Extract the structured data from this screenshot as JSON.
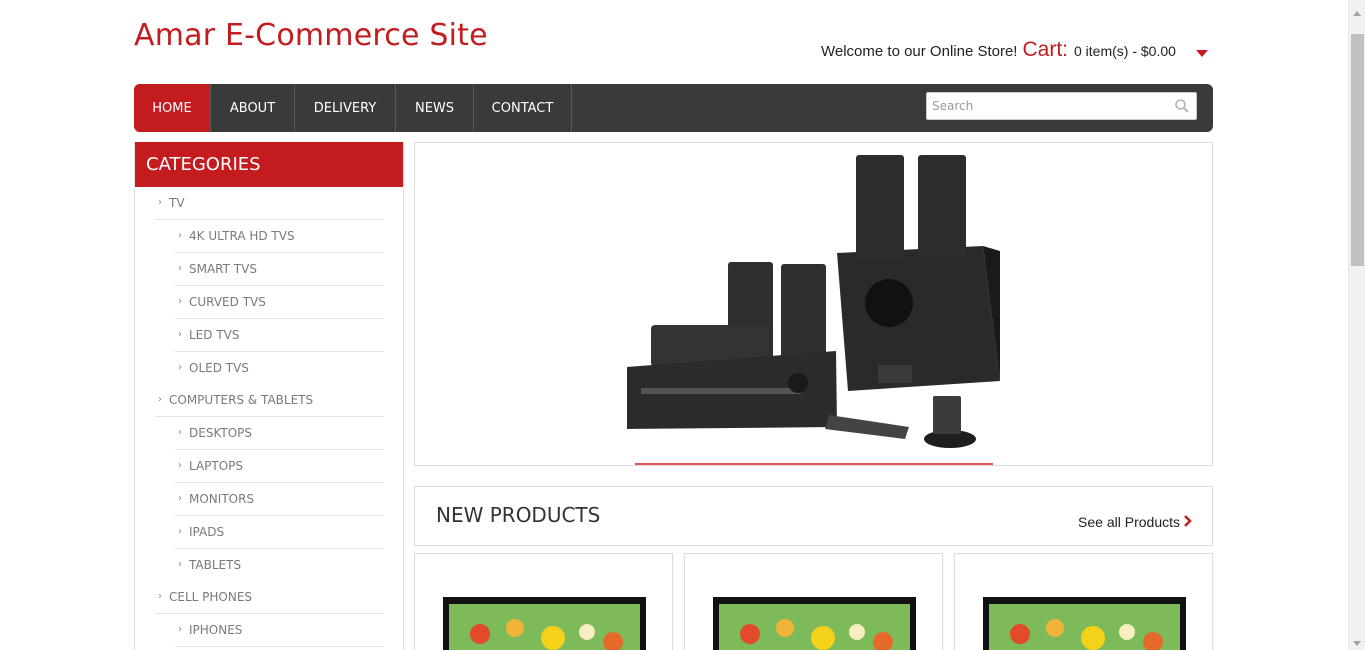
{
  "site": {
    "title": "Amar E-Commerce Site"
  },
  "header": {
    "welcome": "Welcome to our Online Store!",
    "cart_label": "Cart:",
    "cart_summary": "0 item(s) - $0.00"
  },
  "nav": {
    "items": [
      "HOME",
      "ABOUT",
      "DELIVERY",
      "NEWS",
      "CONTACT"
    ],
    "active": "HOME",
    "search_placeholder": "Search"
  },
  "sidebar": {
    "title": "CATEGORIES",
    "items": [
      {
        "label": "TV",
        "level": 0
      },
      {
        "label": "4K ULTRA HD TVS",
        "level": 1
      },
      {
        "label": "SMART TVS",
        "level": 1
      },
      {
        "label": "CURVED TVS",
        "level": 1
      },
      {
        "label": "LED TVS",
        "level": 1
      },
      {
        "label": "OLED TVS",
        "level": 1
      },
      {
        "label": "COMPUTERS & TABLETS",
        "level": 0
      },
      {
        "label": "DESKTOPS",
        "level": 1
      },
      {
        "label": "LAPTOPS",
        "level": 1
      },
      {
        "label": "MONITORS",
        "level": 1
      },
      {
        "label": "IPADS",
        "level": 1
      },
      {
        "label": "TABLETS",
        "level": 1
      },
      {
        "label": "CELL PHONES",
        "level": 0
      },
      {
        "label": "IPHONES",
        "level": 1
      }
    ]
  },
  "new_products": {
    "title": "NEW PRODUCTS",
    "see_all": "See all Products"
  },
  "colors": {
    "accent": "#c41b1f",
    "nav_bg": "#3a3a3a"
  }
}
